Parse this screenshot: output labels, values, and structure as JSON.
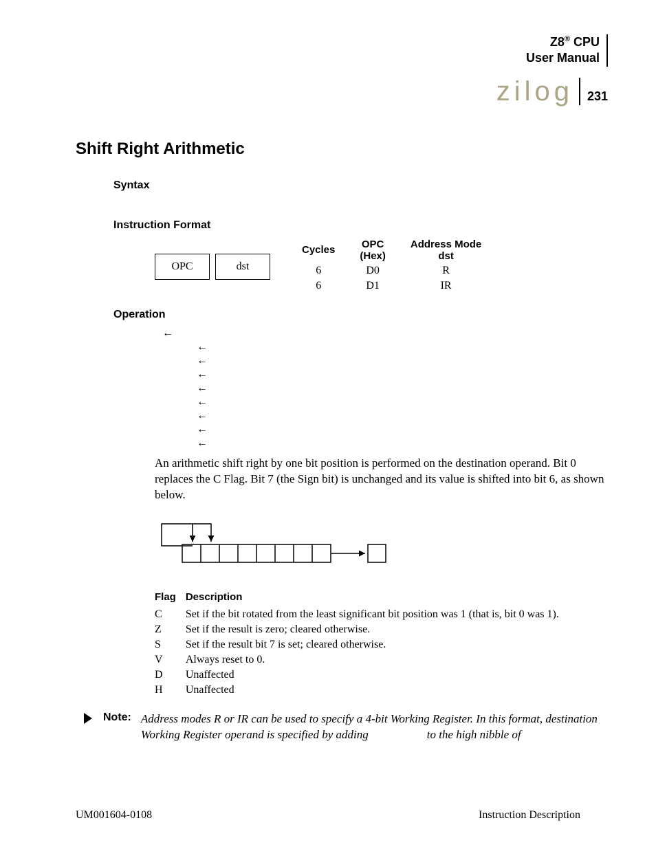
{
  "header": {
    "product_line1": "Z8",
    "reg": "®",
    "product_line1_suffix": " CPU",
    "product_line2": "User Manual",
    "logo_text": "zilog",
    "page_number": "231"
  },
  "title": "Shift Right Arithmetic",
  "syntax_heading": "Syntax",
  "format_heading": "Instruction Format",
  "opcode_boxes": {
    "box1": "OPC",
    "box2": "dst"
  },
  "format_table": {
    "headers": {
      "cycles": "Cycles",
      "opc": "OPC\n(Hex)",
      "addr": "Address Mode\ndst"
    },
    "rows": [
      {
        "cycles": "6",
        "opc": "D0",
        "addr": "R"
      },
      {
        "cycles": "6",
        "opc": "D1",
        "addr": "IR"
      }
    ]
  },
  "operation_heading": "Operation",
  "operation_arrow": "←",
  "operation_paragraph": "An arithmetic shift right by one bit position is performed on the destination operand. Bit 0 replaces the C Flag. Bit 7 (the Sign bit) is unchanged and its value is shifted into bit 6, as shown below.",
  "flags_heading": {
    "flag": "Flag",
    "desc": "Description"
  },
  "flags": [
    {
      "flag": "C",
      "desc": "Set if the bit rotated from the least significant bit position was 1 (that is, bit 0 was 1)."
    },
    {
      "flag": "Z",
      "desc": "Set if the result is zero; cleared otherwise."
    },
    {
      "flag": "S",
      "desc": "Set if the result bit 7 is set; cleared otherwise."
    },
    {
      "flag": "V",
      "desc": "Always reset to 0."
    },
    {
      "flag": "D",
      "desc": "Unaffected"
    },
    {
      "flag": "H",
      "desc": "Unaffected"
    }
  ],
  "note": {
    "label": "Note:",
    "text_prefix": "Address modes R or IR can be used to specify a 4-bit Working Register. In this format, destination Working Register operand is specified by adding ",
    "text_suffix": " to the high nibble of"
  },
  "footer": {
    "left": "UM001604-0108",
    "right": "Instruction Description"
  }
}
